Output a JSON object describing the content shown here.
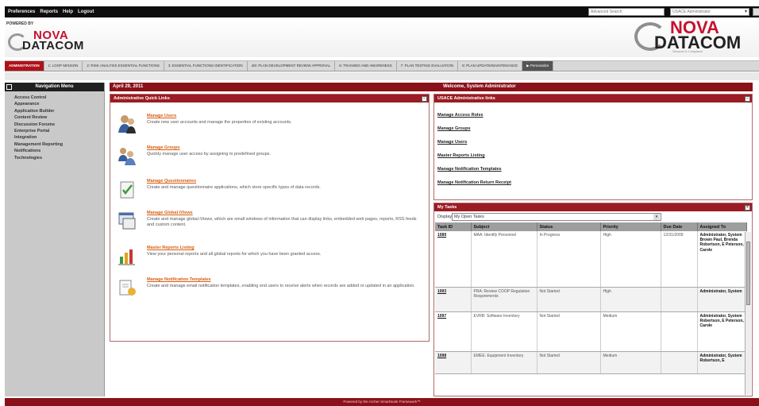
{
  "topbar": {
    "links": [
      "Preferences",
      "Reports",
      "Help",
      "Logout"
    ],
    "search_placeholder": "Advanced Search",
    "dropdown_value": "USACE Administrator"
  },
  "header": {
    "powered_by": "POWERED BY",
    "logo_nova": "NOVA",
    "logo_datacom": "DATACOM",
    "logo_tagline": "Secured & Compliant"
  },
  "tabs": [
    {
      "label": "ADMINISTRATION",
      "active": true
    },
    {
      "label": "1: LOOP MISSION",
      "active": false
    },
    {
      "label": "2: RISK ANALYSIS ESSENTIAL FUNCTIONS",
      "active": false
    },
    {
      "label": "3: ESSENTIAL FUNCTIONS IDENTIFICATION",
      "active": false
    },
    {
      "label": "4/5: PLAN DEVELOPMENT REVIEW APPROVAL",
      "active": false
    },
    {
      "label": "6: TRAINING AND AWARENESS",
      "active": false
    },
    {
      "label": "7: PLAN TESTING EVALUATION",
      "active": false
    },
    {
      "label": "8: PLAN UPDATE/MAINTENANCE",
      "active": false
    }
  ],
  "tab_more": "Personalize",
  "sidebar": {
    "title": "Navigation Menu",
    "items": [
      "Access Control",
      "Appearance",
      "Application Builder",
      "Content Review",
      "Discussion Forums",
      "Enterprise Portal",
      "Integration",
      "Management Reporting",
      "Notifications",
      "Technologies"
    ]
  },
  "datebar": {
    "date": "April 29, 2011",
    "welcome": "Welcome, System Administrator"
  },
  "quick_links": {
    "title": "Administrative Quick Links",
    "items": [
      {
        "title": "Manage Users",
        "desc": "Create new user accounts and manage the properties of existing accounts.",
        "icon": "users-icon"
      },
      {
        "title": "Manage Groups",
        "desc": "Quickly manage user access by assigning to predefined groups.",
        "icon": "groups-icon"
      },
      {
        "title": "Manage Questionnaires",
        "desc": "Create and manage questionnaire applications, which store specific types of data records.",
        "icon": "questionnaire-icon"
      },
      {
        "title": "Manage Global iViews",
        "desc": "Create and manage global iViews, which are small windows of information that can display links, embedded web pages, reports, RSS feeds and custom content.",
        "icon": "iviews-icon"
      },
      {
        "title": "Master Reports Listing",
        "desc": "View your personal reports and all global reports for which you have been granted access.",
        "icon": "reports-icon"
      },
      {
        "title": "Manage Notification Templates",
        "desc": "Create and manage email notification templates, enabling end users to receive alerts when records are added or updated in an application.",
        "icon": "notification-icon"
      }
    ]
  },
  "usace": {
    "title": "USACE Administrative links",
    "links": [
      "Manage Access Roles",
      "Manage Groups",
      "Manage Users",
      "Master Reports Listing",
      "Manage Notification Templates",
      "Manage Notification Return Receipt"
    ]
  },
  "tasks": {
    "title": "My Tasks",
    "display_label": "Display:",
    "display_value": "My Open Tasks",
    "columns": [
      "Task ID",
      "Subject",
      "Status",
      "Priority",
      "Due Date",
      "Assigned To"
    ],
    "rows": [
      {
        "id": "1089",
        "subject": "MAA: Identify Personnel",
        "status": "In Progress",
        "priority": "High",
        "due": "12/31/2009",
        "assigned": "Administrator, System Brown Paul, Brenda Robertson, E Peterson, Carole"
      },
      {
        "id": "1093",
        "subject": "PRA: Review COOP Regulation Requirements",
        "status": "Not Started",
        "priority": "High",
        "due": "",
        "assigned": "Administrator, System"
      },
      {
        "id": "1097",
        "subject": "EVRB: Software Inventory",
        "status": "Not Started",
        "priority": "Medium",
        "due": "",
        "assigned": "Administrator, System Robertson, E Peterson, Carole"
      },
      {
        "id": "1098",
        "subject": "EMEE: Equipment Inventory",
        "status": "Not Started",
        "priority": "Medium",
        "due": "",
        "assigned": "Administrator, System Robertson, E"
      }
    ]
  },
  "footer": "Powered by the Archer SmartSuite Framework™"
}
